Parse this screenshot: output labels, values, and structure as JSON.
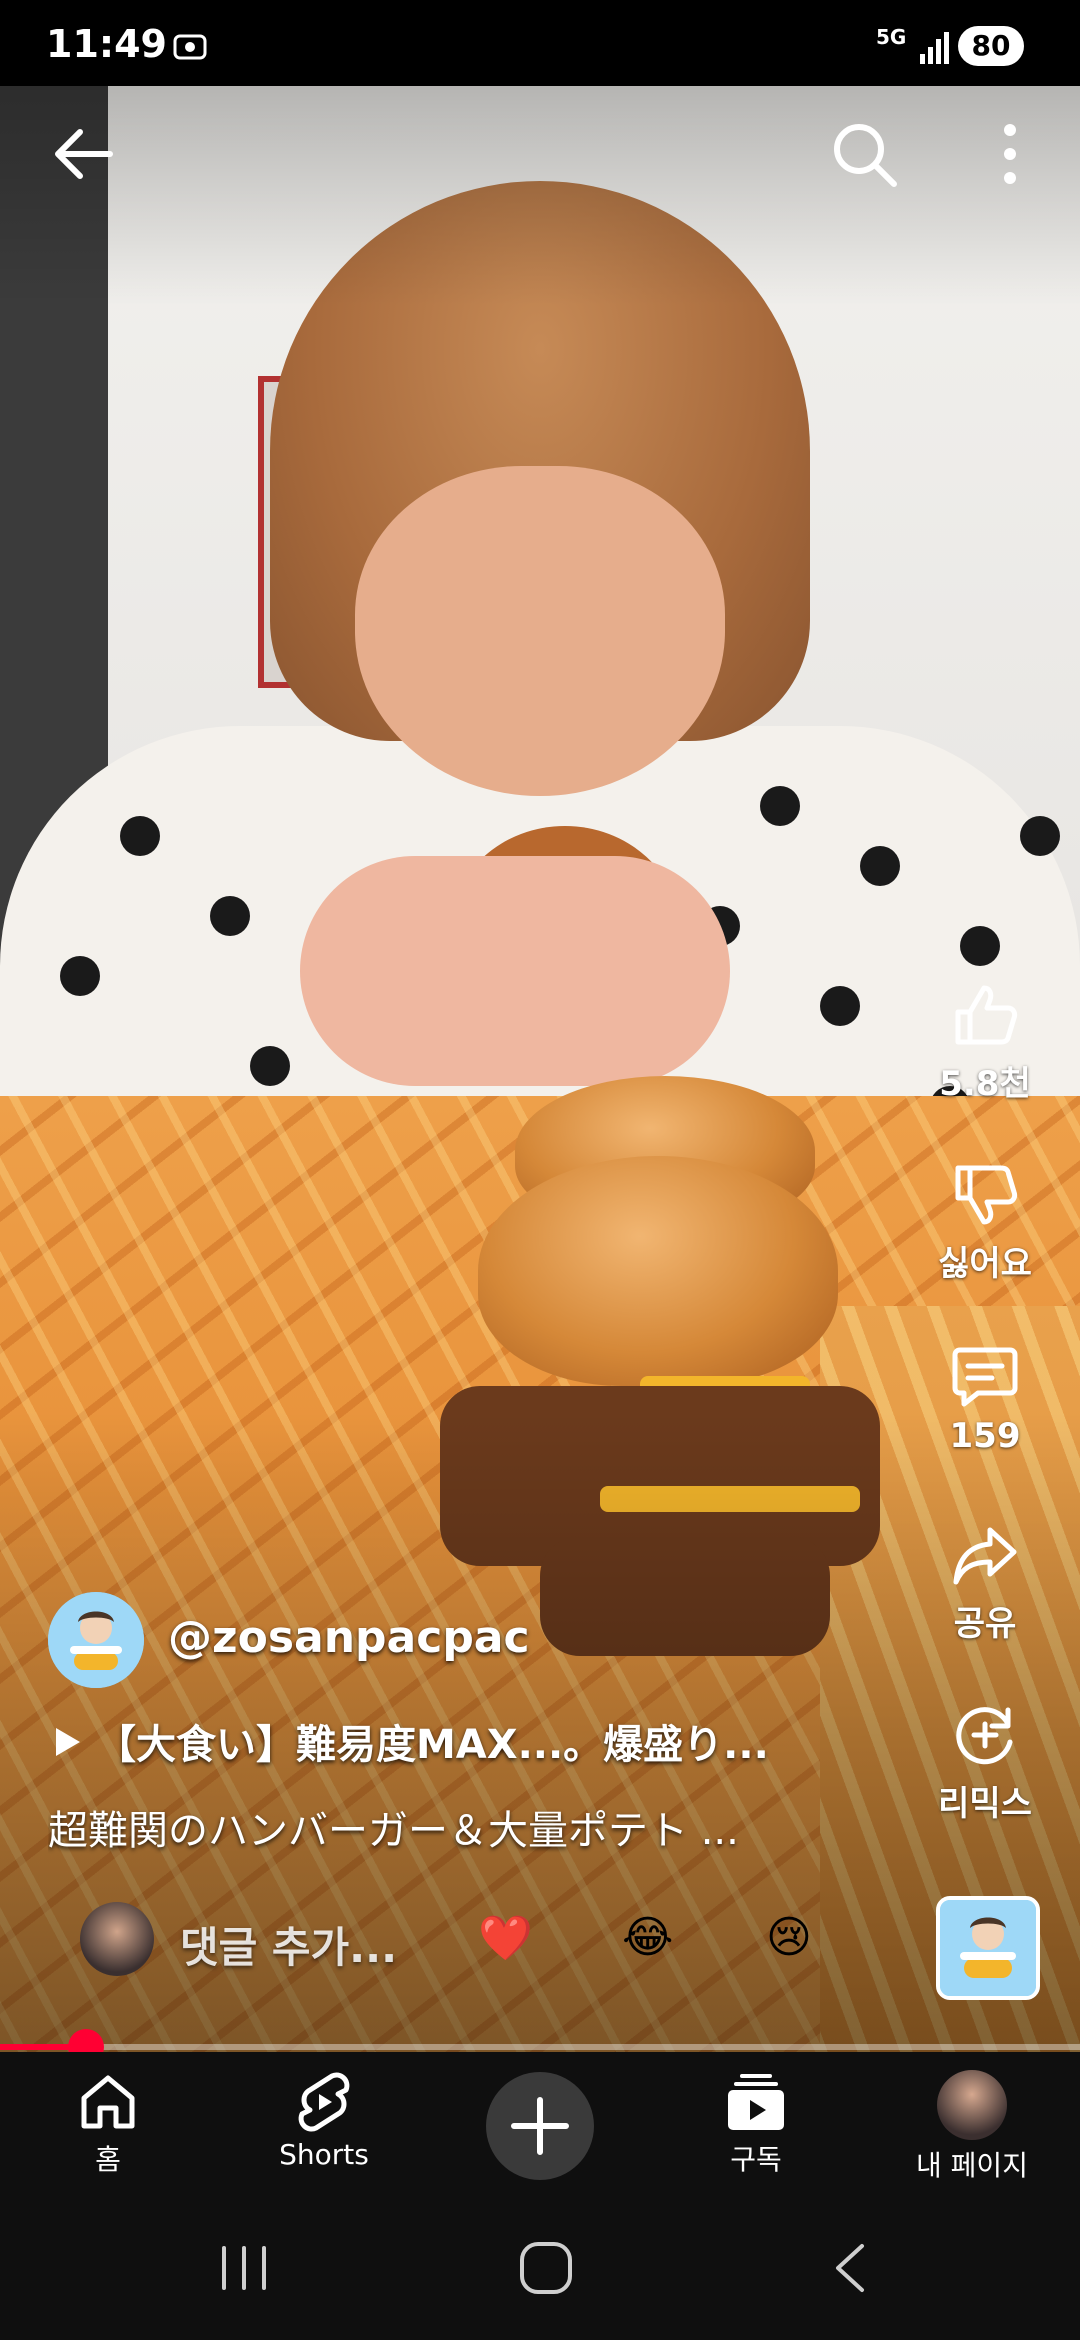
{
  "status_bar": {
    "time": "11:49",
    "network": "5G",
    "battery": "80"
  },
  "video": {
    "description_icons": [
      "back-arrow-icon",
      "search-icon",
      "more-vertical-icon"
    ]
  },
  "actions": {
    "like_count": "5.8천",
    "dislike_label": "싫어요",
    "comment_count": "159",
    "share_label": "공유",
    "remix_label": "리믹스"
  },
  "channel": {
    "handle": "@zosanpacpac"
  },
  "video_info": {
    "title": "【大食い】難易度MAX...。爆盛り...",
    "subtitle": "超難関のハンバーガー＆大量ポテト ..."
  },
  "comment_bar": {
    "placeholder": "댓글 추가...",
    "emojis": [
      "❤️",
      "😂",
      "😢"
    ]
  },
  "progress": {
    "fraction": 0.08,
    "color": "#ff0033"
  },
  "bottom_nav": {
    "home": "홈",
    "shorts": "Shorts",
    "subscriptions": "구독",
    "my_page": "내 페이지"
  },
  "colors": {
    "background": "#0f0f0f",
    "accent": "#ff0033"
  }
}
